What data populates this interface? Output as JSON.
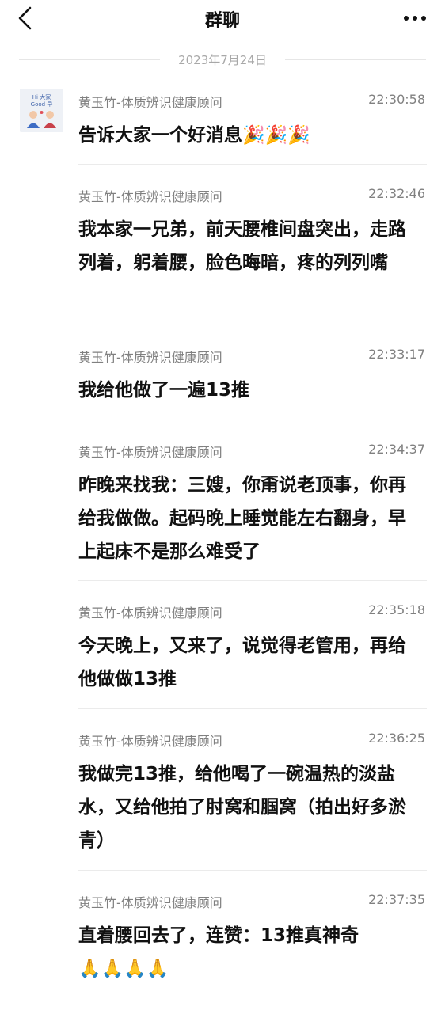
{
  "header": {
    "title": "群聊",
    "back_icon": "chevron-left-icon",
    "more_icon": "more-horizontal-icon"
  },
  "date_divider": "2023年7月24日",
  "avatar": {
    "icon": "group-avatar-icon",
    "lines": [
      "Hi 大家",
      "Good 早"
    ]
  },
  "messages": [
    {
      "sender": "黄玉竹-体质辨识健康顾问",
      "time": "22:30:58",
      "text": "告诉大家一个好消息",
      "emoji": "🎉🎉🎉"
    },
    {
      "sender": "黄玉竹-体质辨识健康顾问",
      "time": "22:32:46",
      "text": "我本家一兄弟，前天腰椎间盘突出，走路列着，躬着腰，脸色晦暗，疼的列列嘴",
      "emoji": ""
    },
    {
      "sender": "黄玉竹-体质辨识健康顾问",
      "time": "22:33:17",
      "text": "我给他做了一遍13推",
      "emoji": ""
    },
    {
      "sender": "黄玉竹-体质辨识健康顾问",
      "time": "22:34:37",
      "text": "昨晚来找我：三嫂，你甭说老顶事，你再给我做做。起码晚上睡觉能左右翻身，早上起床不是那么难受了",
      "emoji": ""
    },
    {
      "sender": "黄玉竹-体质辨识健康顾问",
      "time": "22:35:18",
      "text": "今天晚上，又来了，说觉得老管用，再给他做做13推",
      "emoji": ""
    },
    {
      "sender": "黄玉竹-体质辨识健康顾问",
      "time": "22:36:25",
      "text": "我做完13推，给他喝了一碗温热的淡盐水，又给他拍了肘窝和腘窝（拍出好多淤青）",
      "emoji": ""
    },
    {
      "sender": "黄玉竹-体质辨识健康顾问",
      "time": "22:37:35",
      "text": "直着腰回去了，连赞：13推真神奇",
      "emoji": "🙏🙏🙏🙏"
    }
  ]
}
